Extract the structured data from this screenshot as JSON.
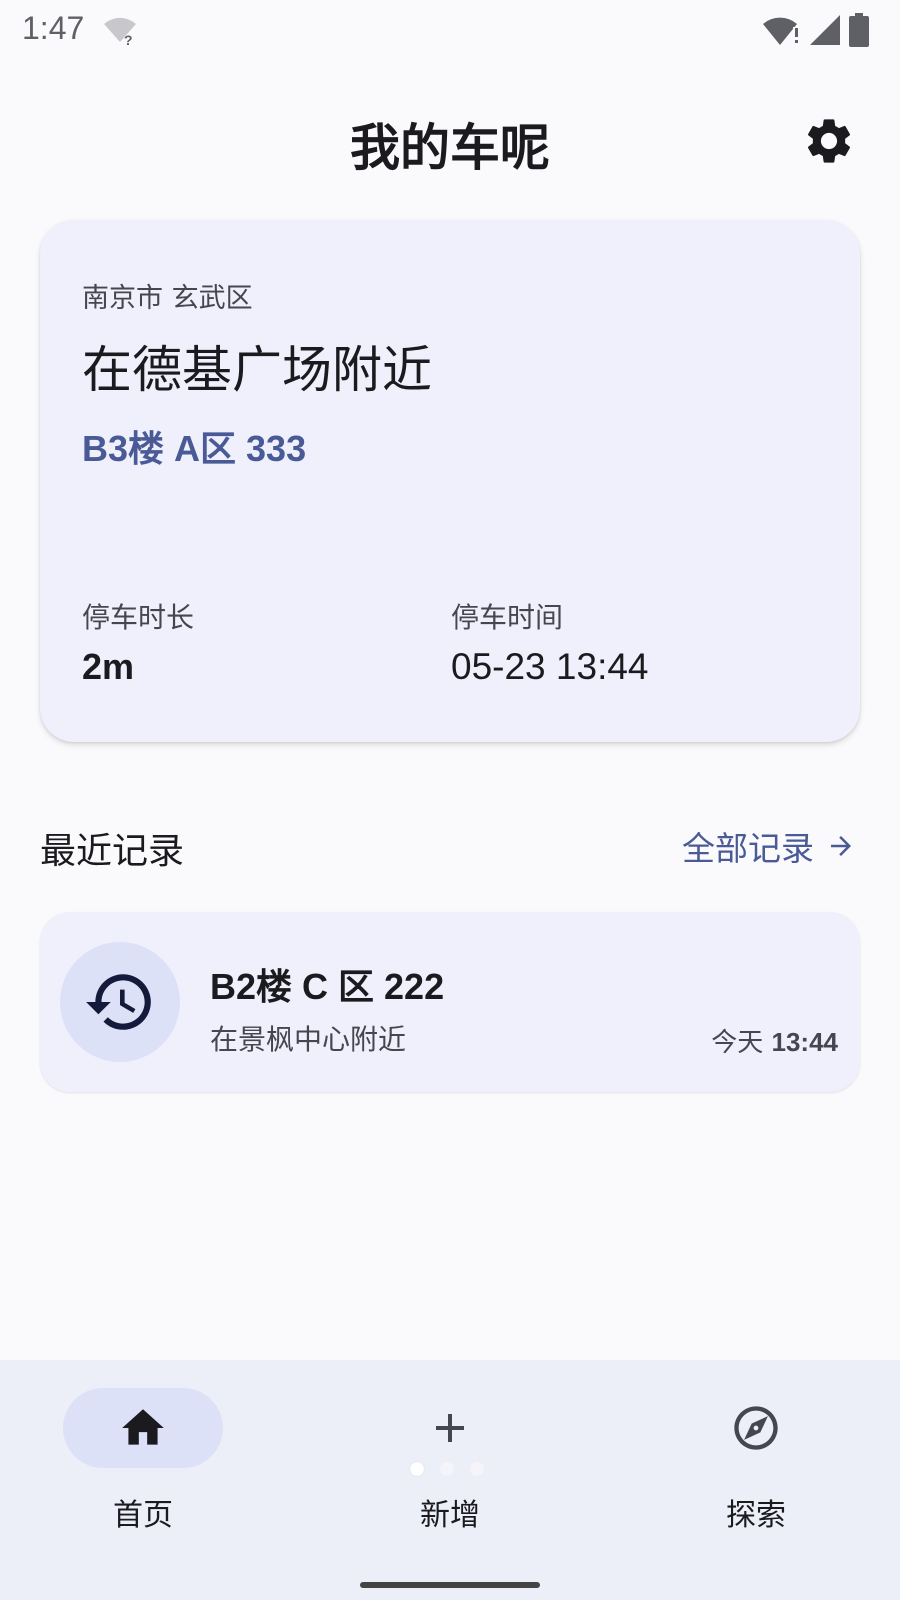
{
  "status_bar": {
    "time": "1:47",
    "wifi_icon": "wifi-question-icon",
    "right_icons": [
      "wifi-alert-icon",
      "cell-signal-icon",
      "battery-icon"
    ]
  },
  "header": {
    "title": "我的车呢",
    "settings_icon": "gear-icon"
  },
  "current_parking": {
    "city_district": "南京市 玄武区",
    "nearby": "在德基广场附近",
    "spot": "B3楼 A区 333",
    "duration_label": "停车时长",
    "duration_value": "2m",
    "time_label": "停车时间",
    "time_value": "05-23 13:44"
  },
  "recent": {
    "title": "最近记录",
    "all_label": "全部记录",
    "records": [
      {
        "icon": "history-icon",
        "spot": "B2楼 C 区 222",
        "nearby": "在景枫中心附近",
        "day": "今天",
        "time": "13:44"
      }
    ]
  },
  "bottom_nav": {
    "items": [
      {
        "label": "首页",
        "icon": "home-icon",
        "active": true
      },
      {
        "label": "新增",
        "icon": "plus-icon",
        "active": false
      },
      {
        "label": "探索",
        "icon": "compass-icon",
        "active": false
      }
    ]
  },
  "colors": {
    "accent": "#4a5a96",
    "card_bg": "#eff0fb",
    "nav_bg": "#eceef8",
    "active_pill": "#dde1f8"
  }
}
